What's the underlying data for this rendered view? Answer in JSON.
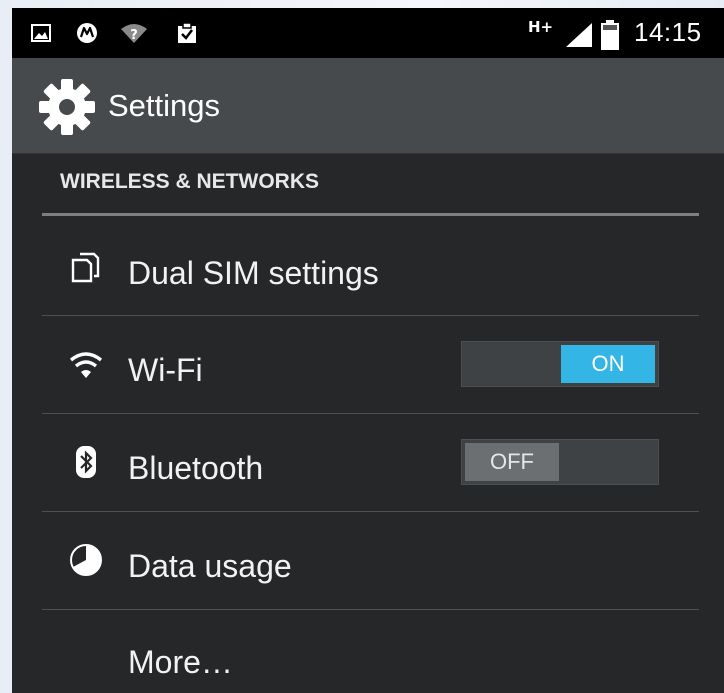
{
  "status_bar": {
    "icons": [
      "gallery-icon",
      "motorola-icon",
      "wifi-question-icon",
      "clipboard-check-icon"
    ],
    "network_type": "H+",
    "time": "14:15"
  },
  "action_bar": {
    "title": "Settings",
    "icon": "gear-icon"
  },
  "section": {
    "header": "WIRELESS & NETWORKS"
  },
  "rows": [
    {
      "label": "Dual SIM settings",
      "icon": "dual-sim-icon"
    },
    {
      "label": "Wi-Fi",
      "icon": "wifi-icon",
      "toggle": "ON",
      "state": true
    },
    {
      "label": "Bluetooth",
      "icon": "bluetooth-icon",
      "toggle": "OFF",
      "state": false
    },
    {
      "label": "Data usage",
      "icon": "data-usage-icon"
    },
    {
      "label": "More…"
    }
  ],
  "colors": {
    "accent": "#33b5e5",
    "background": "#252729",
    "action_bar": "#474a4c"
  }
}
